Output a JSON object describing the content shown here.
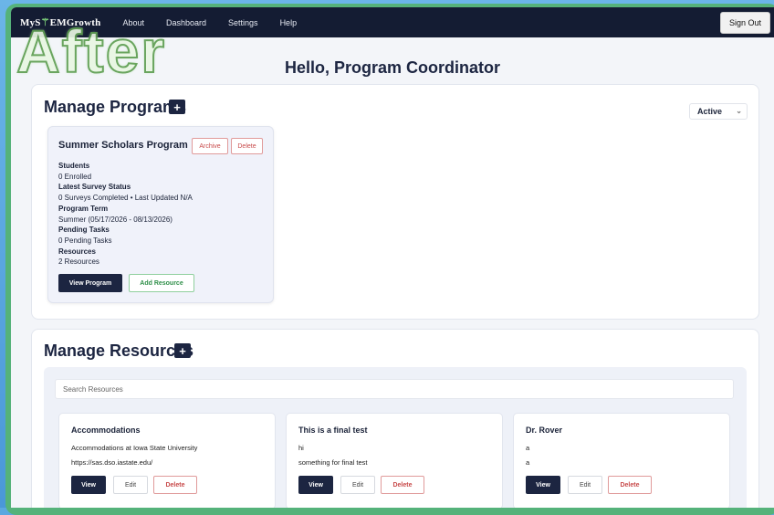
{
  "navbar": {
    "brand_prefix": "MyS",
    "brand_symbol": "⚚",
    "brand_suffix": "EMGrowth",
    "links": [
      "About",
      "Dashboard",
      "Settings",
      "Help"
    ],
    "sign_out": "Sign Out"
  },
  "watermark": "After",
  "greeting": "Hello, Program Coordinator",
  "programs": {
    "title": "Manage Programs",
    "add": "+",
    "filter_value": "Active",
    "cards": [
      {
        "title": "Summer Scholars Program",
        "archive": "Archive",
        "delete": "Delete",
        "students_label": "Students",
        "students_value": "0 Enrolled",
        "survey_label": "Latest Survey Status",
        "survey_value": "0 Surveys Completed • Last Updated N/A",
        "term_label": "Program Term",
        "term_value": "Summer (05/17/2026 - 08/13/2026)",
        "tasks_label": "Pending Tasks",
        "tasks_value": "0 Pending Tasks",
        "resources_label": "Resources",
        "resources_value": "2 Resources",
        "view": "View Program",
        "add_resource": "Add Resource"
      }
    ]
  },
  "resources": {
    "title": "Manage Resources",
    "add": "+",
    "search_placeholder": "Search Resources",
    "cards": [
      {
        "title": "Accommodations",
        "line1": "Accommodations at Iowa State University",
        "line2": "https://sas.dso.iastate.edu/",
        "view": "View",
        "edit": "Edit",
        "delete": "Delete"
      },
      {
        "title": "This is a final test",
        "line1": "hi",
        "line2": "something for final test",
        "view": "View",
        "edit": "Edit",
        "delete": "Delete"
      },
      {
        "title": "Dr. Rover",
        "line1": "a",
        "line2": "a",
        "view": "View",
        "edit": "Edit",
        "delete": "Delete"
      }
    ]
  }
}
